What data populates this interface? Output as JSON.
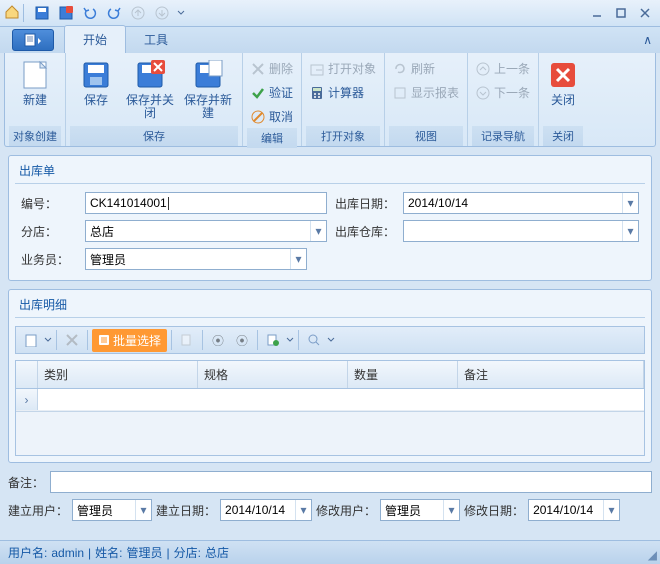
{
  "tabs": {
    "start": "开始",
    "tools": "工具"
  },
  "ribbon": {
    "new": "新建",
    "g_create": "对象创建",
    "save": "保存",
    "save_close": "保存并关闭",
    "save_new": "保存并新建",
    "g_save": "保存",
    "delete": "删除",
    "validate": "验证",
    "cancel": "取消",
    "g_edit": "编辑",
    "open_obj": "打开对象",
    "calc": "计算器",
    "g_open": "打开对象",
    "refresh": "刷新",
    "show_report": "显示报表",
    "g_view": "视图",
    "prev": "上一条",
    "next": "下一条",
    "g_nav": "记录导航",
    "close": "关闭",
    "g_close": "关闭"
  },
  "panel": {
    "title": "出库单",
    "no_lbl": "编号：",
    "no_val": "CK141014001",
    "date_lbl": "出库日期：",
    "date_val": "2014/10/14",
    "branch_lbl": "分店：",
    "branch_val": "总店",
    "wh_lbl": "出库仓库：",
    "wh_val": "",
    "clerk_lbl": "业务员：",
    "clerk_val": "管理员"
  },
  "detail": {
    "title": "出库明细",
    "batch": "批量选择",
    "cols": {
      "cat": "类别",
      "spec": "规格",
      "qty": "数量",
      "remark": "备注"
    }
  },
  "remark_lbl": "备注：",
  "audit": {
    "cu_lbl": "建立用户：",
    "cu_val": "管理员",
    "cd_lbl": "建立日期：",
    "cd_val": "2014/10/14",
    "mu_lbl": "修改用户：",
    "mu_val": "管理员",
    "md_lbl": "修改日期：",
    "md_val": "2014/10/14"
  },
  "status": {
    "user_lbl": "用户名:",
    "user": "admin",
    "name_lbl": "姓名:",
    "name": "管理员",
    "branch_lbl": "分店:",
    "branch": "总店"
  }
}
